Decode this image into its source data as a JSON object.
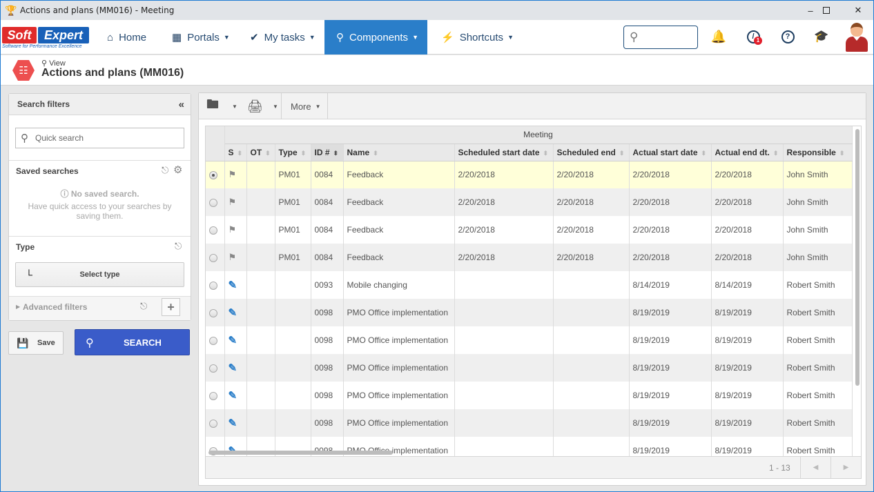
{
  "window": {
    "title": "Actions and plans (MM016) - Meeting",
    "controls": [
      "minimize",
      "maximize",
      "close"
    ]
  },
  "brand": {
    "name_part1": "Soft",
    "name_part2": "Expert",
    "tagline": "Software for Performance Excellence",
    "reg": "®"
  },
  "nav": {
    "items": [
      {
        "label": "Home",
        "icon": "home-icon",
        "has_caret": false,
        "active": false
      },
      {
        "label": "Portals",
        "icon": "grid-icon",
        "has_caret": true,
        "active": false
      },
      {
        "label": "My tasks",
        "icon": "check-icon",
        "has_caret": true,
        "active": false
      },
      {
        "label": "Components",
        "icon": "trophy-icon",
        "has_caret": true,
        "active": true
      },
      {
        "label": "Shortcuts",
        "icon": "lightning-icon",
        "has_caret": true,
        "active": false
      }
    ],
    "search_placeholder": "",
    "notification_badge": "1",
    "accent_color": "#2a7ec9"
  },
  "page": {
    "mode_label": "View",
    "title": "Actions and plans (MM016)"
  },
  "filters": {
    "header": "Search filters",
    "quick_search_placeholder": "Quick search",
    "saved_searches": {
      "title": "Saved searches",
      "empty_title": "No saved search.",
      "empty_hint": "Have quick access to your searches by saving them."
    },
    "type": {
      "title": "Type",
      "button_label": "Select type"
    },
    "advanced": {
      "title": "Advanced filters"
    },
    "save_label": "Save",
    "search_label": "SEARCH"
  },
  "toolbar": {
    "more_label": "More"
  },
  "grid": {
    "group_header": "Meeting",
    "columns": [
      "S",
      "OT",
      "Type",
      "ID #",
      "Name",
      "Scheduled start date",
      "Scheduled end",
      "Actual start date",
      "Actual end dt.",
      "Responsible"
    ],
    "sorted_column": "ID #",
    "rows": [
      {
        "selected": true,
        "status_icon": "flag-icon",
        "ot": "",
        "type": "PM01",
        "id": "0084",
        "name": "Feedback",
        "sched_start": "2/20/2018",
        "sched_end": "2/20/2018",
        "actual_start": "2/20/2018",
        "actual_end": "2/20/2018",
        "responsible": "John Smith"
      },
      {
        "selected": false,
        "status_icon": "flag-icon",
        "ot": "",
        "type": "PM01",
        "id": "0084",
        "name": "Feedback",
        "sched_start": "2/20/2018",
        "sched_end": "2/20/2018",
        "actual_start": "2/20/2018",
        "actual_end": "2/20/2018",
        "responsible": "John Smith"
      },
      {
        "selected": false,
        "status_icon": "flag-icon",
        "ot": "",
        "type": "PM01",
        "id": "0084",
        "name": "Feedback",
        "sched_start": "2/20/2018",
        "sched_end": "2/20/2018",
        "actual_start": "2/20/2018",
        "actual_end": "2/20/2018",
        "responsible": "John Smith"
      },
      {
        "selected": false,
        "status_icon": "flag-icon",
        "ot": "",
        "type": "PM01",
        "id": "0084",
        "name": "Feedback",
        "sched_start": "2/20/2018",
        "sched_end": "2/20/2018",
        "actual_start": "2/20/2018",
        "actual_end": "2/20/2018",
        "responsible": "John Smith"
      },
      {
        "selected": false,
        "status_icon": "pencil-icon",
        "ot": "",
        "type": "",
        "id": "0093",
        "name": "Mobile changing",
        "sched_start": "",
        "sched_end": "",
        "actual_start": "8/14/2019",
        "actual_end": "8/14/2019",
        "responsible": "Robert Smith"
      },
      {
        "selected": false,
        "status_icon": "pencil-icon",
        "ot": "",
        "type": "",
        "id": "0098",
        "name": "PMO Office implementation",
        "sched_start": "",
        "sched_end": "",
        "actual_start": "8/19/2019",
        "actual_end": "8/19/2019",
        "responsible": "Robert Smith"
      },
      {
        "selected": false,
        "status_icon": "pencil-icon",
        "ot": "",
        "type": "",
        "id": "0098",
        "name": "PMO Office implementation",
        "sched_start": "",
        "sched_end": "",
        "actual_start": "8/19/2019",
        "actual_end": "8/19/2019",
        "responsible": "Robert Smith"
      },
      {
        "selected": false,
        "status_icon": "pencil-icon",
        "ot": "",
        "type": "",
        "id": "0098",
        "name": "PMO Office implementation",
        "sched_start": "",
        "sched_end": "",
        "actual_start": "8/19/2019",
        "actual_end": "8/19/2019",
        "responsible": "Robert Smith"
      },
      {
        "selected": false,
        "status_icon": "pencil-icon",
        "ot": "",
        "type": "",
        "id": "0098",
        "name": "PMO Office implementation",
        "sched_start": "",
        "sched_end": "",
        "actual_start": "8/19/2019",
        "actual_end": "8/19/2019",
        "responsible": "Robert Smith"
      },
      {
        "selected": false,
        "status_icon": "pencil-icon",
        "ot": "",
        "type": "",
        "id": "0098",
        "name": "PMO Office implementation",
        "sched_start": "",
        "sched_end": "",
        "actual_start": "8/19/2019",
        "actual_end": "8/19/2019",
        "responsible": "Robert Smith"
      },
      {
        "selected": false,
        "status_icon": "pencil-icon",
        "ot": "",
        "type": "",
        "id": "0098",
        "name": "PMO Office implementation",
        "sched_start": "",
        "sched_end": "",
        "actual_start": "8/19/2019",
        "actual_end": "8/19/2019",
        "responsible": "Robert Smith"
      }
    ],
    "pager_text": "1 - 13"
  }
}
